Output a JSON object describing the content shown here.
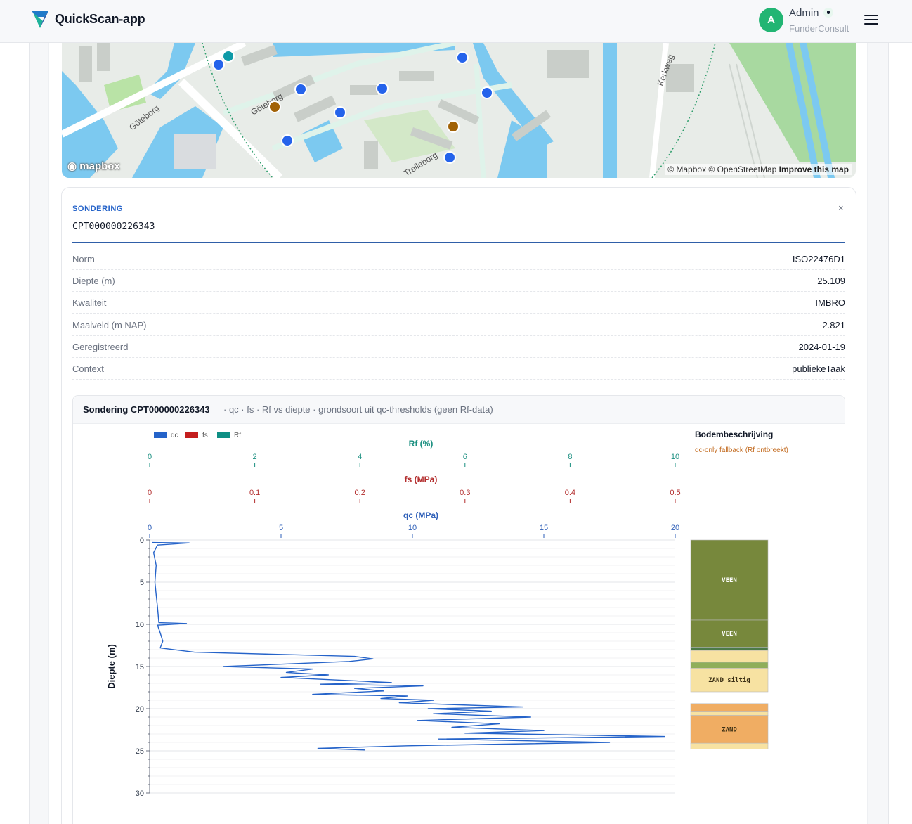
{
  "app": {
    "title": "QuickScan-app"
  },
  "user": {
    "initial": "A",
    "name": "Admin",
    "org": "FunderConsult"
  },
  "map": {
    "street_labels": [
      "Göteborg",
      "Göteborg",
      "Kerkweg",
      "Trelleborg"
    ],
    "attribution_prefix": "© Mapbox © OpenStreetMap",
    "attribution_link": "Improve this map",
    "logo_text": "mapbox",
    "colors": {
      "marker_blue": "#2563eb",
      "marker_teal": "#0e9aa7",
      "marker_brown": "#a16207",
      "water": "#7cc9f0",
      "land": "#e6ece6"
    }
  },
  "sondering": {
    "section_label": "SONDERING",
    "id": "CPT000000226343",
    "close_label": "×",
    "properties": [
      {
        "key": "Norm",
        "value": "ISO22476D1"
      },
      {
        "key": "Diepte (m)",
        "value": "25.109"
      },
      {
        "key": "Kwaliteit",
        "value": "IMBRO"
      },
      {
        "key": "Maaiveld (m NAP)",
        "value": "-2.821"
      },
      {
        "key": "Geregistreerd",
        "value": "2024-01-19"
      },
      {
        "key": "Context",
        "value": "publiekeTaak"
      }
    ]
  },
  "chart_panel": {
    "title": "Sondering CPT000000226343",
    "subtitle": "· qc · fs · Rf vs diepte · grondsoort uit qc-thresholds (geen Rf-data)",
    "bodem_title": "Bodembeschrijving",
    "bodem_note": "qc-only fallback (Rf ontbreekt)"
  },
  "chart_data": {
    "type": "line",
    "legend": [
      {
        "name": "qc",
        "color": "#2563c9"
      },
      {
        "name": "fs",
        "color": "#c41e1e"
      },
      {
        "name": "Rf",
        "color": "#0e8f84"
      }
    ],
    "axes": {
      "rf": {
        "label": "Rf (%)",
        "ticks": [
          0,
          2,
          4,
          6,
          8,
          10
        ],
        "range": [
          0,
          10
        ],
        "color": "#1a8f80"
      },
      "fs": {
        "label": "fs (MPa)",
        "ticks": [
          "0",
          "0.1",
          "0.2",
          "0.3",
          "0.4",
          "0.5"
        ],
        "range": [
          0,
          0.5
        ],
        "color": "#b32d2d"
      },
      "qc": {
        "label": "qc (MPa)",
        "ticks": [
          0,
          5,
          10,
          15,
          20
        ],
        "range": [
          0,
          20
        ],
        "color": "#2e5fb8"
      },
      "y": {
        "label": "Diepte (m)",
        "ticks": [
          0,
          5,
          10,
          15,
          20,
          25,
          30
        ],
        "range": [
          0,
          30
        ],
        "inverted": true
      }
    },
    "grid": true,
    "series": [
      {
        "name": "qc",
        "color": "#2563c9",
        "points": [
          [
            0.1,
            0.3
          ],
          [
            1.5,
            0.35
          ],
          [
            0.3,
            0.6
          ],
          [
            0.15,
            1.5
          ],
          [
            0.25,
            3
          ],
          [
            0.2,
            5
          ],
          [
            0.25,
            6.5
          ],
          [
            0.3,
            8
          ],
          [
            0.35,
            9.8
          ],
          [
            1.4,
            9.9
          ],
          [
            0.3,
            10.1
          ],
          [
            0.4,
            11
          ],
          [
            0.5,
            12
          ],
          [
            0.4,
            12.8
          ],
          [
            1.7,
            13.3
          ],
          [
            7.8,
            13.8
          ],
          [
            8.5,
            14.1
          ],
          [
            7.6,
            14.4
          ],
          [
            2.8,
            15.0
          ],
          [
            6.2,
            15.3
          ],
          [
            5.2,
            15.7
          ],
          [
            6.8,
            16.0
          ],
          [
            5.0,
            16.3
          ],
          [
            9.2,
            16.9
          ],
          [
            6.5,
            17.1
          ],
          [
            10.4,
            17.3
          ],
          [
            7.8,
            17.6
          ],
          [
            8.9,
            17.9
          ],
          [
            6.2,
            18.3
          ],
          [
            9.8,
            18.5
          ],
          [
            8.8,
            18.8
          ],
          [
            10.8,
            19.0
          ],
          [
            9.5,
            19.3
          ],
          [
            14.2,
            19.8
          ],
          [
            10.6,
            20.0
          ],
          [
            13.0,
            20.3
          ],
          [
            10.8,
            20.6
          ],
          [
            14.5,
            21.0
          ],
          [
            10.2,
            21.4
          ],
          [
            13.3,
            21.8
          ],
          [
            11.5,
            22.2
          ],
          [
            15.0,
            22.6
          ],
          [
            12.0,
            22.9
          ],
          [
            19.6,
            23.3
          ],
          [
            11.0,
            23.6
          ],
          [
            17.5,
            24.0
          ],
          [
            9.8,
            24.4
          ],
          [
            6.4,
            24.7
          ],
          [
            8.2,
            24.9
          ]
        ]
      }
    ],
    "soil_layers": [
      {
        "label": "VEEN",
        "from": 0.0,
        "to": 9.5,
        "color": "#77883c"
      },
      {
        "label": "VEEN",
        "from": 9.5,
        "to": 12.7,
        "color": "#77883c"
      },
      {
        "label": "",
        "from": 12.7,
        "to": 13.1,
        "color": "#4c7a48"
      },
      {
        "label": "",
        "from": 13.1,
        "to": 14.5,
        "color": "#f7e2a2"
      },
      {
        "label": "",
        "from": 14.5,
        "to": 15.2,
        "color": "#8fae5a"
      },
      {
        "label": "ZAND siltig",
        "from": 15.2,
        "to": 18.0,
        "color": "#f7e2a2"
      },
      {
        "label": "",
        "from": 19.4,
        "to": 20.3,
        "color": "#f0ad63"
      },
      {
        "label": "",
        "from": 20.3,
        "to": 20.8,
        "color": "#f7e2a2"
      },
      {
        "label": "ZAND",
        "from": 20.8,
        "to": 24.1,
        "color": "#f0ad63"
      },
      {
        "label": "",
        "from": 24.1,
        "to": 24.8,
        "color": "#f7e2a2"
      }
    ]
  }
}
